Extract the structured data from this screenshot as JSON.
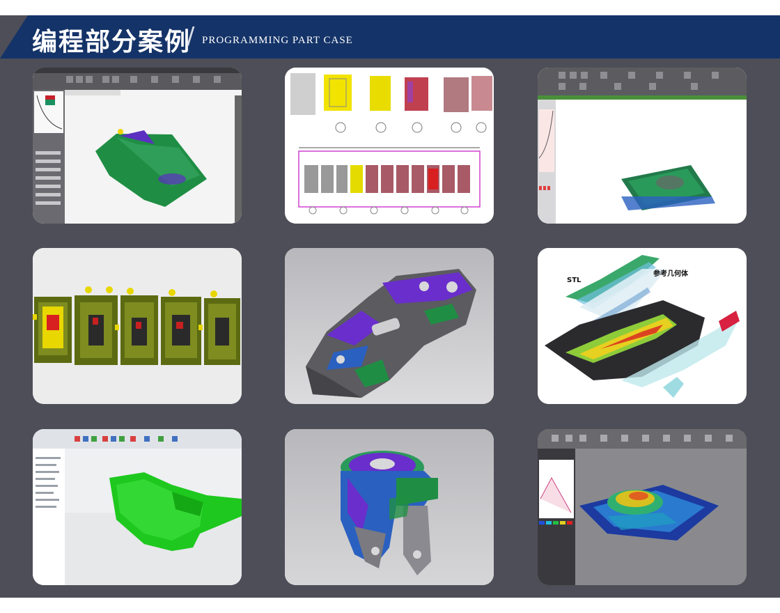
{
  "header": {
    "title_cn": "编程部分案例",
    "divider": "/",
    "title_en": "PROGRAMMING PART CASE"
  },
  "gallery": {
    "cards": [
      {
        "id": 1,
        "kind": "cad-screenshot"
      },
      {
        "id": 2,
        "kind": "die-layout-drawing"
      },
      {
        "id": 3,
        "kind": "cad-screenshot"
      },
      {
        "id": 4,
        "kind": "progressive-die-render"
      },
      {
        "id": 5,
        "kind": "bracket-render"
      },
      {
        "id": 6,
        "kind": "stl-reference-diagram",
        "label_stl": "STL",
        "label_ref": "参考几何体"
      },
      {
        "id": 7,
        "kind": "cad-screenshot"
      },
      {
        "id": 8,
        "kind": "casting-render"
      },
      {
        "id": 9,
        "kind": "cad-screenshot"
      }
    ]
  },
  "colors": {
    "banner": "#143368",
    "panel": "#4e4e58",
    "accent_green": "#1f8e44",
    "accent_purple": "#6a2ecc"
  }
}
